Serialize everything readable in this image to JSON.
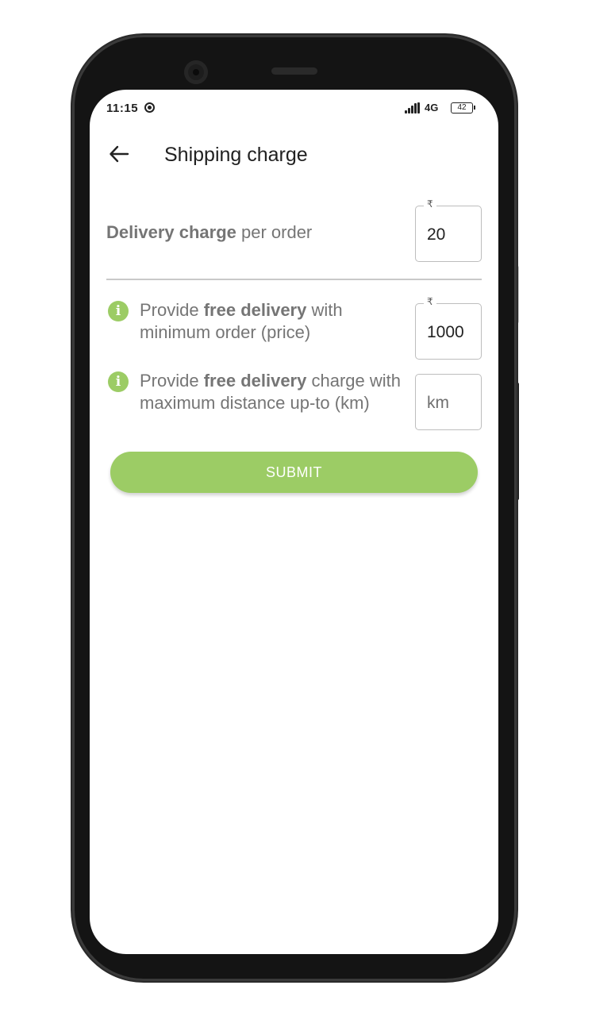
{
  "status_bar": {
    "time": "11:15",
    "network": "4G",
    "battery": "42"
  },
  "app_bar": {
    "title": "Shipping charge",
    "back_icon": "arrow-left-icon"
  },
  "delivery_charge": {
    "label_bold": "Delivery charge",
    "label_rest": " per order",
    "currency": "₹",
    "value": "20"
  },
  "free_delivery_min_order": {
    "prefix": "Provide ",
    "bold": "free delivery",
    "suffix": " with minimum order (price)",
    "currency": "₹",
    "value": "1000",
    "icon": "info-icon"
  },
  "free_delivery_distance": {
    "prefix": "Provide ",
    "bold": "free delivery",
    "suffix": " charge with maximum distance up-to (km)",
    "placeholder": "km",
    "icon": "info-icon"
  },
  "submit_label": "SUBMIT",
  "colors": {
    "accent": "#9ccc65",
    "label": "#757575",
    "title": "#212121"
  }
}
